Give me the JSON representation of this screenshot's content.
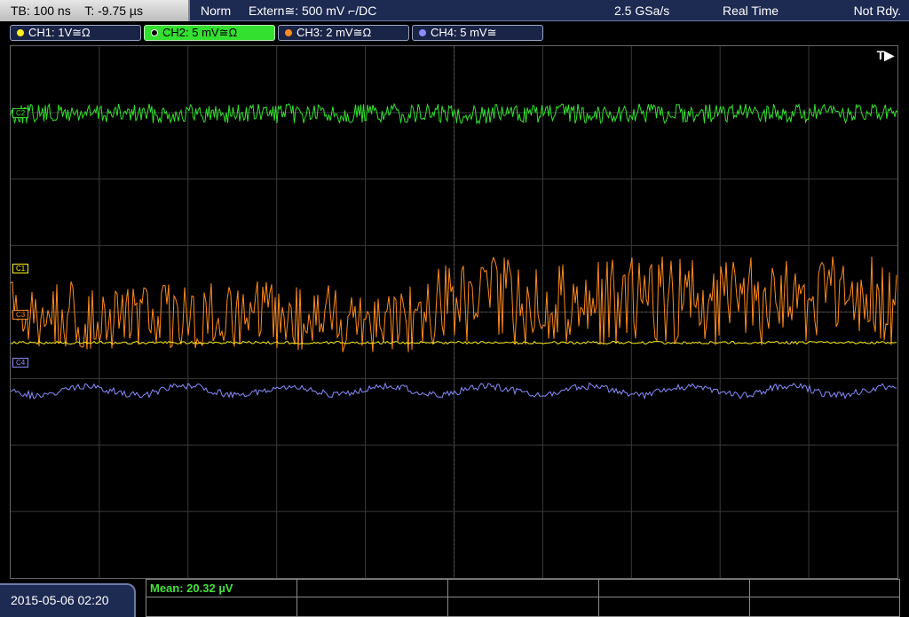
{
  "topbar": {
    "timebase": "TB: 100 ns",
    "trigger_time": "T: -9.75 µs",
    "acq_mode": "Norm",
    "trigger_source": "Extern≅: 500 mV ⌐/DC",
    "sample_rate": "2.5 GSa/s",
    "time_mode": "Real Time",
    "status": "Not Rdy."
  },
  "channels": [
    {
      "label": "CH1: 1V≅Ω",
      "color": "#ffef1a",
      "active": false
    },
    {
      "label": "CH2: 5 mV≅Ω",
      "color": "#33e02f",
      "active": true
    },
    {
      "label": "CH3: 2 mV≅Ω",
      "color": "#ff8a1e",
      "active": false
    },
    {
      "label": "CH4: 5 mV≅",
      "color": "#8a8cff",
      "active": false
    }
  ],
  "markers": {
    "c1": "C1",
    "c2": "C2",
    "c3": "C3",
    "c4": "C4",
    "trigger_badge": "T▶"
  },
  "datetime": "2015-05-06 02:20",
  "measurement": {
    "mean_label": "Mean: 20.32 µV"
  },
  "colors": {
    "grid": "#3a3a3a",
    "ch1": "#ffef1a",
    "ch2": "#33e02f",
    "ch3": "#ff8a1e",
    "ch4": "#8a8cff"
  }
}
